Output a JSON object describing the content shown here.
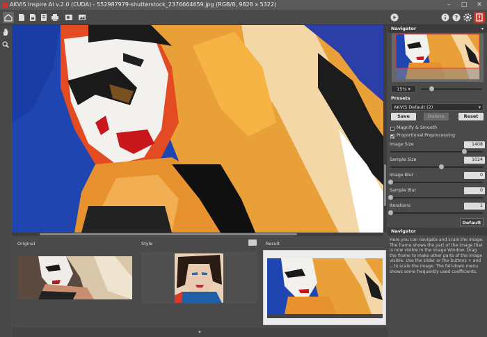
{
  "window": {
    "title": "AKVIS Inspire AI v.2.0 (CUDA) - 552987979-shutterstock_2376664659.jpg (RGB/8, 9828 x 5322)",
    "minimize": "–",
    "maximize": "□",
    "close": "✕"
  },
  "toolbar": {
    "left_icons": [
      "home-icon",
      "open-file-icon",
      "save-file-icon",
      "batch-icon",
      "print-icon",
      "share-icon",
      "gallery-icon"
    ],
    "right_icons": [
      "run-icon",
      "info-icon",
      "help-icon",
      "settings-icon",
      "notifications-icon"
    ]
  },
  "tools": [
    "hand-icon",
    "zoom-icon"
  ],
  "bottom": {
    "original_label": "Original",
    "style_label": "Style",
    "result_label": "Result",
    "toggle_arrow": "▾"
  },
  "navigator": {
    "title": "Navigator",
    "zoom": "15%"
  },
  "presets": {
    "title": "Presets",
    "selected": "AKVIS Default (2)",
    "save": "Save",
    "delete": "Delete",
    "reset": "Reset"
  },
  "params": {
    "magnify_label": "Magnify & Smooth",
    "magnify_checked": false,
    "proportional_label": "Proportional Preprocessing",
    "proportional_checked": true,
    "image_size_label": "Image Size",
    "image_size": "1408",
    "image_size_fraction": 0.8,
    "sample_size_label": "Sample Size",
    "sample_size": "1024",
    "sample_size_fraction": 0.55,
    "image_blur_label": "Image Blur",
    "image_blur": "0",
    "image_blur_fraction": 0,
    "sample_blur_label": "Sample Blur",
    "sample_blur": "0",
    "sample_blur_fraction": 0,
    "iterations_label": "Iterations",
    "iterations": "1",
    "iterations_fraction": 0,
    "default": "Default"
  },
  "help": {
    "title": "Navigator",
    "text": "Here you can navigate and scale the image. The frame shows the part of the image that is now visible in the Image Window. Drag the frame to make other parts of the image visible. Use the slider or the buttons + and -, to scale the image. The fall-down menu shows some frequently used coefficients."
  }
}
